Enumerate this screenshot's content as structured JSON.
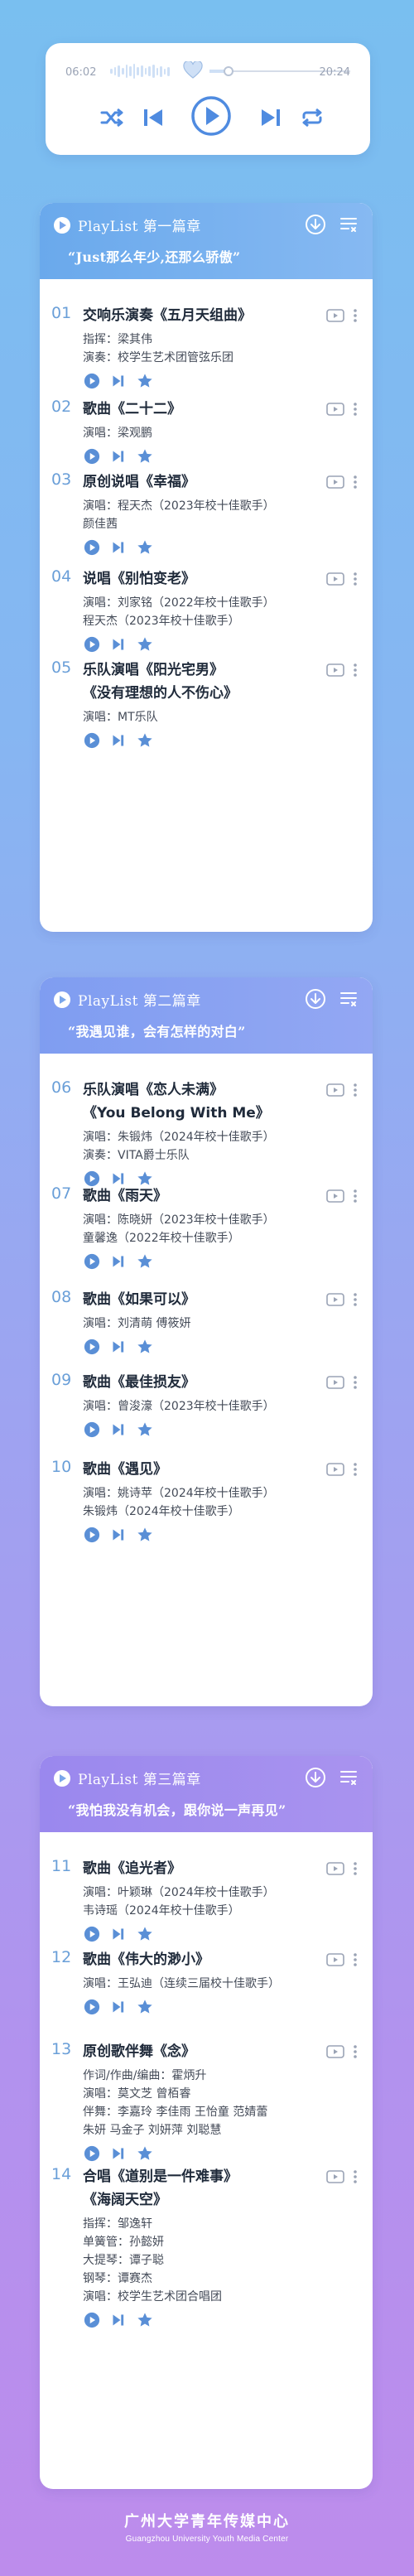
{
  "player": {
    "time_start": "06:02",
    "time_end": "20:24",
    "progress": 0.3,
    "icons": [
      "heart-icon",
      "shuffle-icon",
      "previous-icon",
      "play-icon",
      "next-icon",
      "repeat-icon"
    ]
  },
  "colors": {
    "accent": "#5a8fd6",
    "head_1": "#6aa9ec",
    "head_2": "#7f9df1",
    "head_3": "#9a88ee"
  },
  "sections": [
    {
      "label": "PlayList 第一篇章",
      "subtitle": "“Just那么年少,还那么骄傲”",
      "tracks": [
        {
          "num": "01",
          "title": "交响乐演奏《五月天组曲》",
          "title2": "",
          "credits": [
            "指挥：梁其伟",
            "演奏：校学生艺术团管弦乐团"
          ]
        },
        {
          "num": "02",
          "title": "歌曲《二十二》",
          "title2": "",
          "credits": [
            "演唱：梁观鹏"
          ]
        },
        {
          "num": "03",
          "title": "原创说唱《幸福》",
          "title2": "",
          "credits": [
            "演唱：程天杰（2023年校十佳歌手）",
            "颜佳茜"
          ]
        },
        {
          "num": "04",
          "title": "说唱《别怕变老》",
          "title2": "",
          "credits": [
            "演唱：刘家铭（2022年校十佳歌手）",
            "程天杰（2023年校十佳歌手）"
          ]
        },
        {
          "num": "05",
          "title": "乐队演唱《阳光宅男》",
          "title2": "《没有理想的人不伤心》",
          "credits": [
            "演唱：MT乐队"
          ]
        }
      ]
    },
    {
      "label": "PlayList 第二篇章",
      "subtitle": "“我遇见谁，会有怎样的对白”",
      "tracks": [
        {
          "num": "06",
          "title": "乐队演唱《恋人未满》",
          "title2": "《You Belong With Me》",
          "credits": [
            "演唱：朱锻炜（2024年校十佳歌手）",
            "演奏：VITA爵士乐队"
          ]
        },
        {
          "num": "07",
          "title": "歌曲《雨天》",
          "title2": "",
          "credits": [
            "演唱：陈晓妍（2023年校十佳歌手）",
            "童馨逸（2022年校十佳歌手）"
          ]
        },
        {
          "num": "08",
          "title": "歌曲《如果可以》",
          "title2": "",
          "credits": [
            "演唱：刘清萌 傅筱妍"
          ]
        },
        {
          "num": "09",
          "title": "歌曲《最佳损友》",
          "title2": "",
          "credits": [
            "演唱：曾浚濠（2023年校十佳歌手）"
          ]
        },
        {
          "num": "10",
          "title": "歌曲《遇见》",
          "title2": "",
          "credits": [
            "演唱：姚诗苹（2024年校十佳歌手）",
            "朱锻炜（2024年校十佳歌手）"
          ]
        }
      ]
    },
    {
      "label": "PlayList 第三篇章",
      "subtitle": "“我怕我没有机会，跟你说一声再见”",
      "tracks": [
        {
          "num": "11",
          "title": "歌曲《追光者》",
          "title2": "",
          "credits": [
            "演唱：叶颖琳（2024年校十佳歌手）",
            "韦诗瑶（2024年校十佳歌手）"
          ]
        },
        {
          "num": "12",
          "title": "歌曲《伟大的渺小》",
          "title2": "",
          "credits": [
            "演唱：王弘迪（连续三届校十佳歌手）"
          ]
        },
        {
          "num": "13",
          "title": "原创歌伴舞《念》",
          "title2": "",
          "credits": [
            "作词/作曲/编曲：霍炳升",
            "演唱：莫文芝 曾栢睿",
            "伴舞：李嘉玲 李佳雨 王怡童 范婧蕾",
            "朱妍 马金子 刘妍萍 刘聪慧"
          ]
        },
        {
          "num": "14",
          "title": "合唱《道别是一件难事》",
          "title2": "《海阔天空》",
          "credits": [
            "指挥：邹逸轩",
            "单簧管：孙懿妍",
            "大提琴：谭子聪",
            "钢琴：谭赛杰",
            "演唱：校学生艺术团合唱团"
          ]
        }
      ]
    }
  ],
  "footer": {
    "name_cn": "广州大学青年传媒中心",
    "name_en": "Guangzhou University Youth Media Center"
  }
}
